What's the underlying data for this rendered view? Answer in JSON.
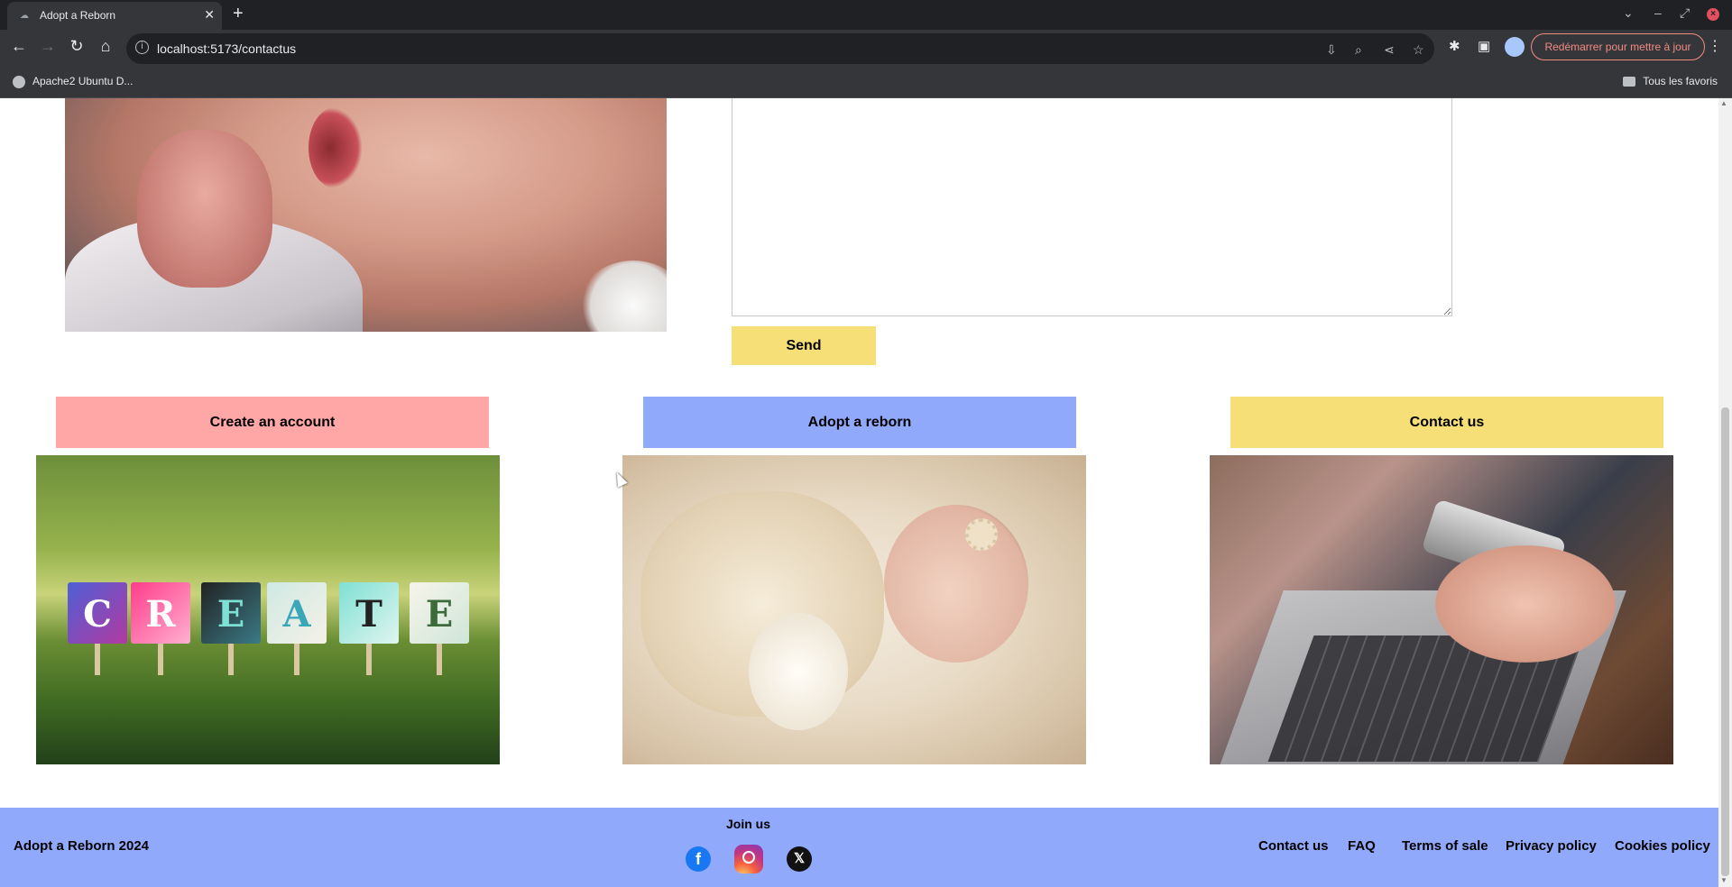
{
  "browser": {
    "tab_title": "Adopt a Reborn",
    "tab_close": "✕",
    "new_tab": "+",
    "url": "localhost:5173/contactus",
    "update_button": "Redémarrer pour mettre à jour",
    "bookmark_item": "Apache2 Ubuntu D...",
    "all_bookmarks": "Tous les favoris"
  },
  "form": {
    "message_value": "",
    "send_label": "Send"
  },
  "cards": [
    {
      "title": "Create an account",
      "color": "#ffa6a6",
      "image": "create-signs-photo"
    },
    {
      "title": "Adopt a reborn",
      "color": "#91a9fb",
      "image": "sleeping-reborn-photo"
    },
    {
      "title": "Contact us",
      "color": "#f5df76",
      "image": "phone-laptop-photo"
    }
  ],
  "create_letters": [
    "C",
    "R",
    "E",
    "A",
    "T",
    "E"
  ],
  "footer": {
    "brand": "Adopt a Reborn 2024",
    "join_us": "Join us",
    "social": [
      "facebook-icon",
      "instagram-icon",
      "x-icon"
    ],
    "links": [
      "Contact us",
      "FAQ",
      "Terms of sale",
      "Privacy policy",
      "Cookies policy"
    ]
  },
  "colors": {
    "footer_bg": "#91a9fb",
    "send_bg": "#f5df76"
  }
}
